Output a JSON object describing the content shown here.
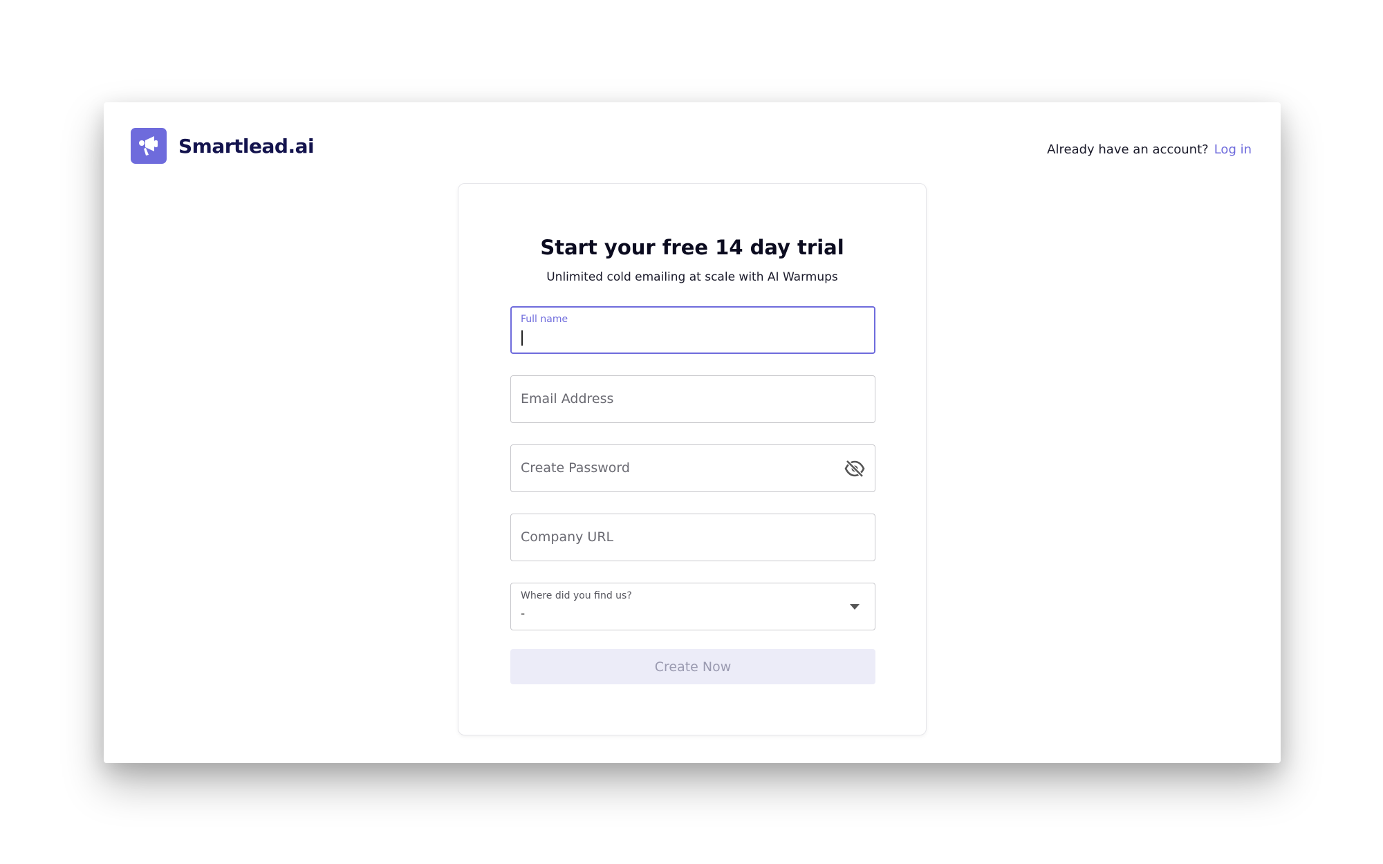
{
  "brand": {
    "name": "Smartlead.ai",
    "accent_color": "#6e6bdc",
    "logo_icon": "megaphone-icon"
  },
  "header": {
    "account_prompt": "Already have an account?",
    "login_label": "Log in"
  },
  "form": {
    "title": "Start your free 14 day trial",
    "subtitle": "Unlimited cold emailing at scale with AI Warmups",
    "full_name": {
      "label": "Full name",
      "value": ""
    },
    "email": {
      "placeholder": "Email Address"
    },
    "password": {
      "placeholder": "Create Password",
      "toggle_icon": "eye-off-icon"
    },
    "company_url": {
      "placeholder": "Company URL"
    },
    "source": {
      "label": "Where did you find us?",
      "value": "-",
      "icon": "caret-down-icon"
    },
    "submit_label": "Create Now"
  }
}
